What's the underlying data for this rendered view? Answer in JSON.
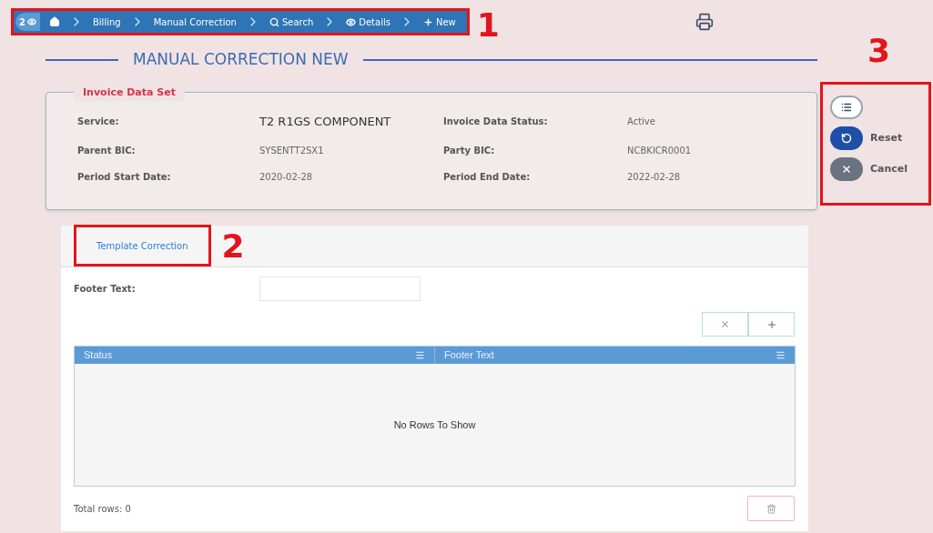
{
  "breadcrumb": {
    "counter": "2",
    "items": [
      {
        "kind": "home"
      },
      {
        "kind": "text",
        "label": "Billing"
      },
      {
        "kind": "text",
        "label": "Manual Correction"
      },
      {
        "kind": "search",
        "label": "Search"
      },
      {
        "kind": "eye",
        "label": "Details"
      },
      {
        "kind": "plus",
        "label": "New"
      }
    ]
  },
  "callouts": [
    "1",
    "2",
    "3"
  ],
  "title": "MANUAL CORRECTION NEW",
  "invoice_data_set": {
    "legend": "Invoice Data Set",
    "fields": [
      {
        "label": "Service:",
        "value": "T2 R1GS COMPONENT",
        "large": true
      },
      {
        "label": "Invoice Data Status:",
        "value": "Active",
        "large": false
      },
      {
        "label": "Parent BIC:",
        "value": "SYSENTT2SX1",
        "large": false
      },
      {
        "label": "Party BIC:",
        "value": "NCBKICR0001",
        "large": false
      },
      {
        "label": "Period Start Date:",
        "value": "2020-02-28",
        "large": false
      },
      {
        "label": "Period End Date:",
        "value": "2022-02-28",
        "large": false
      }
    ]
  },
  "actions": [
    {
      "kind": "list"
    },
    {
      "kind": "reset",
      "label": "Reset"
    },
    {
      "kind": "cancel",
      "label": "Cancel"
    }
  ],
  "tabs": [
    {
      "label": "Template Correction",
      "selected": true
    }
  ],
  "footer_field": {
    "label": "Footer Text:"
  },
  "table": {
    "columns": [
      "Status",
      "Footer Text"
    ],
    "empty_text": "No Rows To Show"
  },
  "total_rows": "Total rows: 0"
}
